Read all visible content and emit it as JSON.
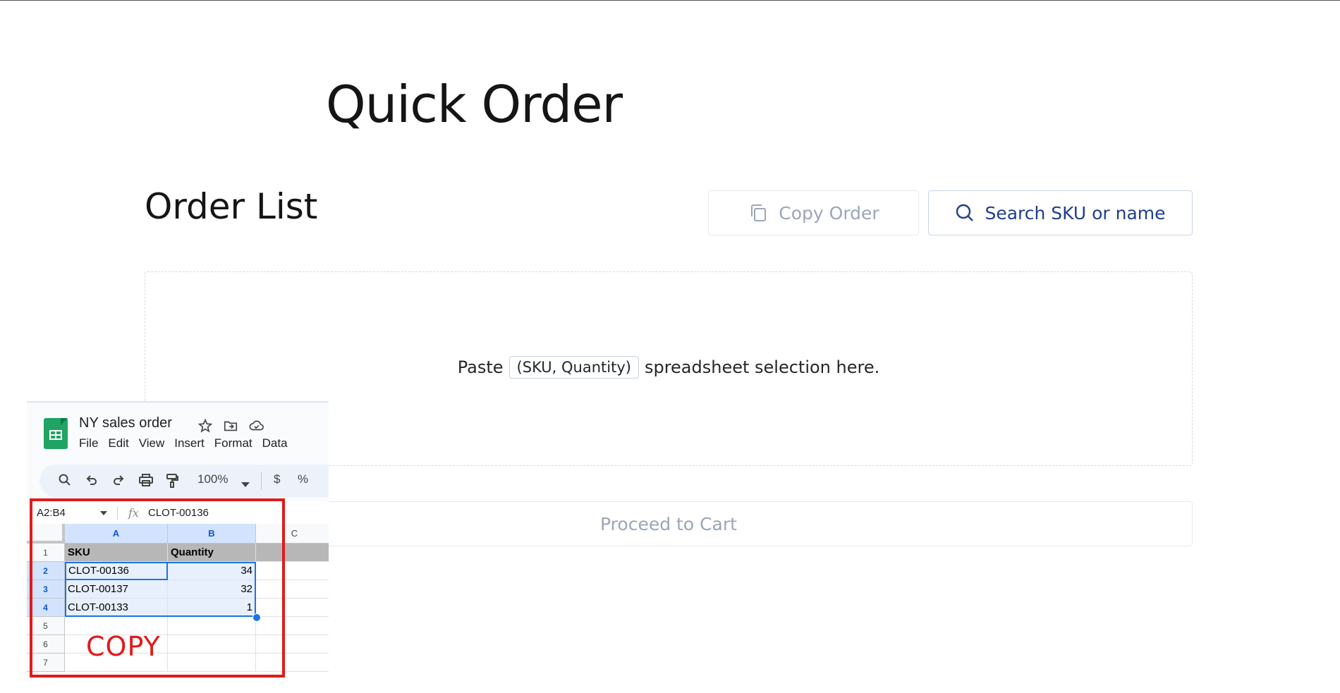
{
  "page": {
    "title": "Quick Order"
  },
  "order_list": {
    "title": "Order List",
    "copy_button": "Copy Order",
    "search_button": "Search SKU or name",
    "paste_prefix": "Paste",
    "paste_chip": "(SKU, Quantity)",
    "paste_suffix": "spreadsheet selection here.",
    "proceed_button": "Proceed to Cart"
  },
  "spreadsheet": {
    "doc_title": "NY sales order",
    "menu": [
      "File",
      "Edit",
      "View",
      "Insert",
      "Format",
      "Data"
    ],
    "zoom": "100%",
    "currency_symbol": "$",
    "percent_symbol": "%",
    "name_box": "A2:B4",
    "fx_label": "fx",
    "formula": "CLOT-00136",
    "columns": [
      "A",
      "B",
      "C"
    ],
    "rows": [
      "1",
      "2",
      "3",
      "4",
      "5",
      "6",
      "7"
    ],
    "header": [
      "SKU",
      "Quantity"
    ],
    "data": [
      {
        "sku": "CLOT-00136",
        "qty": "34"
      },
      {
        "sku": "CLOT-00137",
        "qty": "32"
      },
      {
        "sku": "CLOT-00133",
        "qty": "1"
      }
    ]
  },
  "annotation": {
    "label": "COPY",
    "color": "#e01b1b"
  },
  "colors": {
    "accent": "#1f3f8c",
    "muted": "#9aa6b8",
    "sheets_green": "#1fa463",
    "selection": "#1a73e8"
  }
}
